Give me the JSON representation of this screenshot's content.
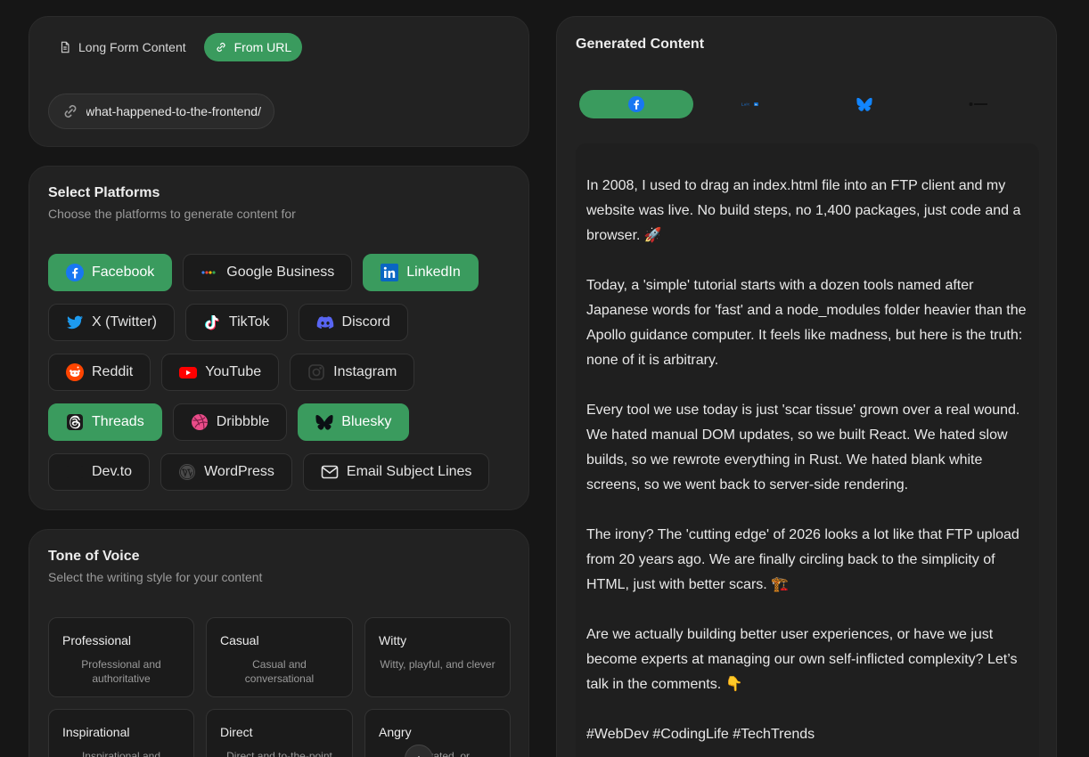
{
  "source": {
    "tabs": [
      {
        "label": "Long Form Content",
        "active": false
      },
      {
        "label": "From URL",
        "active": true
      }
    ],
    "url_value": "/what-happened-to-the-frontend/"
  },
  "platforms": {
    "title": "Select Platforms",
    "subtitle": "Choose the platforms to generate content for",
    "items": [
      {
        "label": "Facebook",
        "selected": true,
        "icon": "facebook-icon"
      },
      {
        "label": "Google Business",
        "selected": false,
        "icon": "google-icon"
      },
      {
        "label": "LinkedIn",
        "selected": true,
        "icon": "linkedin-icon"
      },
      {
        "label": "X (Twitter)",
        "selected": false,
        "icon": "twitter-icon"
      },
      {
        "label": "TikTok",
        "selected": false,
        "icon": "tiktok-icon"
      },
      {
        "label": "Discord",
        "selected": false,
        "icon": "discord-icon"
      },
      {
        "label": "Reddit",
        "selected": false,
        "icon": "reddit-icon"
      },
      {
        "label": "YouTube",
        "selected": false,
        "icon": "youtube-icon"
      },
      {
        "label": "Instagram",
        "selected": false,
        "icon": "instagram-icon"
      },
      {
        "label": "Threads",
        "selected": true,
        "icon": "threads-icon"
      },
      {
        "label": "Dribbble",
        "selected": false,
        "icon": "dribbble-icon"
      },
      {
        "label": "Bluesky",
        "selected": true,
        "icon": "bluesky-icon"
      },
      {
        "label": "Dev.to",
        "selected": false,
        "icon": "devto-icon"
      },
      {
        "label": "WordPress",
        "selected": false,
        "icon": "wordpress-icon"
      },
      {
        "label": "Email Subject Lines",
        "selected": false,
        "icon": "mail-icon"
      }
    ]
  },
  "tone": {
    "title": "Tone of Voice",
    "subtitle": "Select the writing style for your content",
    "items": [
      {
        "name": "Professional",
        "desc": "Professional and authoritative"
      },
      {
        "name": "Casual",
        "desc": "Casual and conversational"
      },
      {
        "name": "Witty",
        "desc": "Witty, playful, and clever"
      },
      {
        "name": "Inspirational",
        "desc": "Inspirational and"
      },
      {
        "name": "Direct",
        "desc": "Direct and to-the-point"
      },
      {
        "name": "Angry",
        "desc": "Frustrated, or"
      }
    ]
  },
  "output": {
    "title": "Generated Content",
    "tabs": [
      {
        "icon": "facebook-icon",
        "active": true
      },
      {
        "icon": "linkedin-icon",
        "active": false
      },
      {
        "icon": "bluesky-icon",
        "active": false
      },
      {
        "icon": "threads-icon",
        "active": false
      }
    ],
    "paragraphs": [
      "In 2008, I used to drag an index.html file into an FTP client and my website was live. No build steps, no 1,400 packages, just code and a browser. 🚀",
      "Today, a 'simple' tutorial starts with a dozen tools named after Japanese words for 'fast' and a node_modules folder heavier than the Apollo guidance computer. It feels like madness, but here is the truth: none of it is arbitrary.",
      "Every tool we use today is just 'scar tissue' grown over a real wound. We hated manual DOM updates, so we built React. We hated slow builds, so we rewrote everything in Rust. We hated blank white screens, so we went back to server-side rendering.",
      "The irony? The 'cutting edge' of 2026 looks a lot like that FTP upload from 20 years ago. We are finally circling back to the simplicity of HTML, just with better scars. 🏗️",
      "Are we actually building better user experiences, or have we just become experts at managing our own self-inflicted complexity? Let’s talk in the comments. 👇",
      "#WebDev #CodingLife #TechTrends"
    ]
  },
  "colors": {
    "accent": "#3a9b5e",
    "background": "#161616",
    "card": "#222222"
  }
}
